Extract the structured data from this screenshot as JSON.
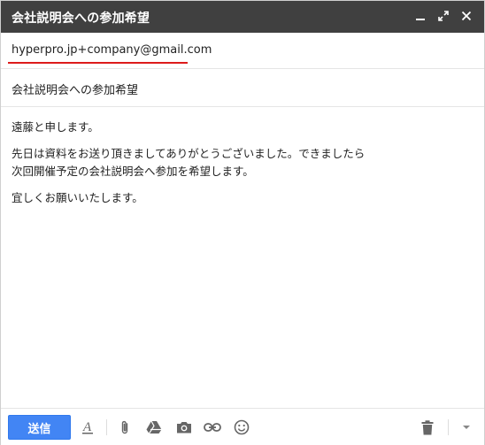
{
  "window": {
    "title": "会社説明会への参加希望"
  },
  "compose": {
    "to": "hyperpro.jp+company@gmail.com",
    "subject": "会社説明会への参加希望",
    "body": {
      "line1": "遠藤と申します。",
      "line2": "先日は資料をお送り頂きましてありがとうございました。できましたら",
      "line3": "次回開催予定の会社説明会へ参加を希望します。",
      "line4": "宜しくお願いいたします。"
    }
  },
  "toolbar": {
    "send_label": "送信",
    "icons": [
      "format-text-icon",
      "attach-icon",
      "drive-icon",
      "camera-icon",
      "link-icon",
      "emoji-icon",
      "trash-icon",
      "more-options-icon"
    ]
  },
  "colors": {
    "titlebar": "#404040",
    "send_button": "#4285f4",
    "underline": "#dd1b1b"
  }
}
